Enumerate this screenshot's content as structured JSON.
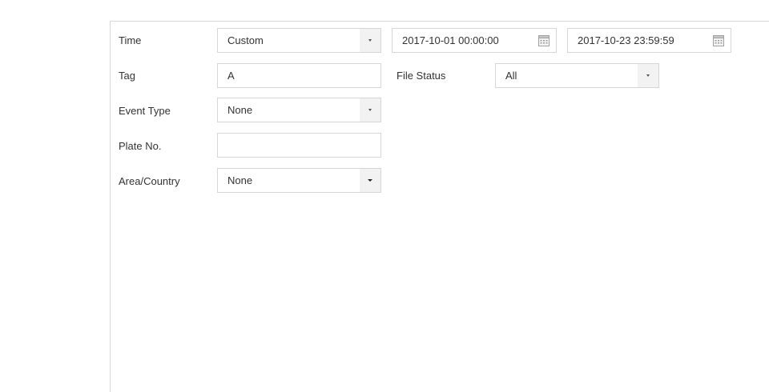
{
  "form": {
    "time": {
      "label": "Time",
      "mode": "Custom",
      "start": "2017-10-01 00:00:00",
      "end": "2017-10-23 23:59:59"
    },
    "tag": {
      "label": "Tag",
      "value": "A"
    },
    "file_status": {
      "label": "File Status",
      "value": "All"
    },
    "event_type": {
      "label": "Event Type",
      "value": "None"
    },
    "plate_no": {
      "label": "Plate No.",
      "value": ""
    },
    "area_country": {
      "label": "Area/Country",
      "value": "None"
    }
  },
  "icons": {
    "dropdown": "caret-down-icon",
    "date_picker": "calendar-icon"
  },
  "colors": {
    "border": "#d6d6d6",
    "button_bg": "#f2f2f2",
    "text": "#333333"
  }
}
